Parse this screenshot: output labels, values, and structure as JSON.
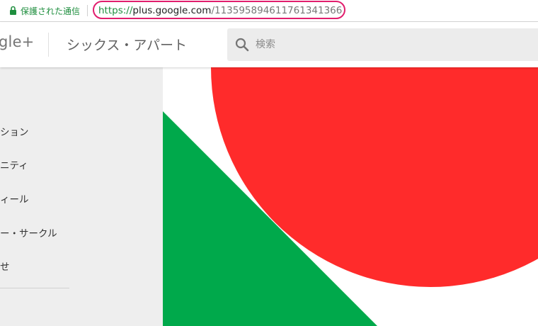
{
  "browser": {
    "secure_label": "保護された通信",
    "url": {
      "scheme": "https://",
      "host": "plus.google.com",
      "path": "/113595894611761341366"
    }
  },
  "header": {
    "logo_text": "gle+",
    "page_title": "シックス・アパート",
    "search_placeholder": "検索"
  },
  "sidebar": {
    "items": [
      {
        "label": "ション"
      },
      {
        "label": "ニティ"
      },
      {
        "label": "ィール"
      },
      {
        "label": "ー・サークル"
      },
      {
        "label": "せ"
      }
    ]
  },
  "colors": {
    "secure_green": "#1e8e3e",
    "highlight_pink": "#e11e6d",
    "cover_red": "#ff2b2b",
    "cover_green": "#00a94b"
  },
  "icons": {
    "lock": "lock-icon",
    "search": "search-icon"
  }
}
